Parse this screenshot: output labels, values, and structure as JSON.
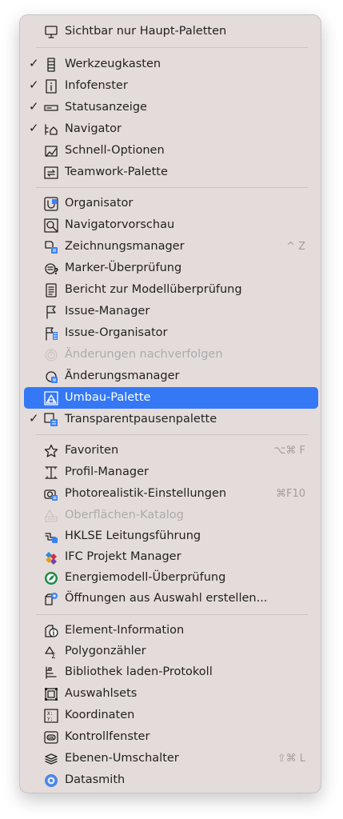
{
  "menu": {
    "items": [
      {
        "label": "Sichtbar nur Haupt-Paletten",
        "icon": "monitor-icon",
        "checked": false
      },
      {
        "label": "Werkzeugkasten",
        "icon": "toolbox-icon",
        "checked": true
      },
      {
        "label": "Infofenster",
        "icon": "info-box-icon",
        "checked": true
      },
      {
        "label": "Statusanzeige",
        "icon": "status-bar-icon",
        "checked": true
      },
      {
        "label": "Navigator",
        "icon": "navigator-tree-icon",
        "checked": true
      },
      {
        "label": "Schnell-Optionen",
        "icon": "quick-options-icon",
        "checked": false
      },
      {
        "label": "Teamwork-Palette",
        "icon": "teamwork-icon",
        "checked": false
      },
      {
        "label": "Organisator",
        "icon": "organizer-icon",
        "checked": false
      },
      {
        "label": "Navigatorvorschau",
        "icon": "preview-magnifier-icon",
        "checked": false
      },
      {
        "label": "Zeichnungsmanager",
        "icon": "drawing-manager-icon",
        "checked": false,
        "shortcut": "^ Z"
      },
      {
        "label": "Marker-Überprüfung",
        "icon": "marker-check-icon",
        "checked": false
      },
      {
        "label": "Bericht zur Modellüberprüfung",
        "icon": "report-icon",
        "checked": false
      },
      {
        "label": "Issue-Manager",
        "icon": "flag-icon",
        "checked": false
      },
      {
        "label": "Issue-Organisator",
        "icon": "issue-organizer-icon",
        "checked": false
      },
      {
        "label": "Änderungen nachverfolgen",
        "icon": "track-changes-icon",
        "checked": false,
        "disabled": true
      },
      {
        "label": "Änderungsmanager",
        "icon": "change-manager-icon",
        "checked": false
      },
      {
        "label": "Umbau-Palette",
        "icon": "renovation-icon",
        "checked": false,
        "selected": true
      },
      {
        "label": "Transparentpausenpalette",
        "icon": "trace-reference-icon",
        "checked": true
      },
      {
        "label": "Favoriten",
        "icon": "star-icon",
        "checked": false,
        "shortcut": "⌥⌘ F"
      },
      {
        "label": "Profil-Manager",
        "icon": "profile-beam-icon",
        "checked": false
      },
      {
        "label": "Photorealistik-Einstellungen",
        "icon": "camera-icon",
        "checked": false,
        "shortcut": "⌘F10"
      },
      {
        "label": "Oberflächen-Katalog",
        "icon": "surface-catalog-icon",
        "checked": false,
        "disabled": true
      },
      {
        "label": "HKLSE Leitungsführung",
        "icon": "mep-routing-icon",
        "checked": false
      },
      {
        "label": "IFC Projekt Manager",
        "icon": "ifc-logo-icon",
        "checked": false
      },
      {
        "label": "Energiemodell-Überprüfung",
        "icon": "energy-globe-icon",
        "checked": false
      },
      {
        "label": "Öffnungen aus Auswahl erstellen...",
        "icon": "create-openings-icon",
        "checked": false
      },
      {
        "label": "Element-Information",
        "icon": "element-info-icon",
        "checked": false
      },
      {
        "label": "Polygonzähler",
        "icon": "polygon-counter-icon",
        "checked": false
      },
      {
        "label": "Bibliothek laden-Protokoll",
        "icon": "library-log-icon",
        "checked": false
      },
      {
        "label": "Auswahlsets",
        "icon": "selection-sets-icon",
        "checked": false
      },
      {
        "label": "Koordinaten",
        "icon": "coordinates-icon",
        "checked": false
      },
      {
        "label": "Kontrollfenster",
        "icon": "control-box-icon",
        "checked": false
      },
      {
        "label": "Ebenen-Umschalter",
        "icon": "layers-icon",
        "checked": false,
        "shortcut": "⇧⌘ L"
      },
      {
        "label": "Datasmith",
        "icon": "datasmith-logo-icon",
        "checked": false
      }
    ],
    "check_mark": "✓",
    "colors": {
      "background": "#e4dcdb",
      "selection": "#3478f6",
      "text": "#222222",
      "disabled_text": "#ababab",
      "shortcut_text": "#a39d9c"
    }
  }
}
